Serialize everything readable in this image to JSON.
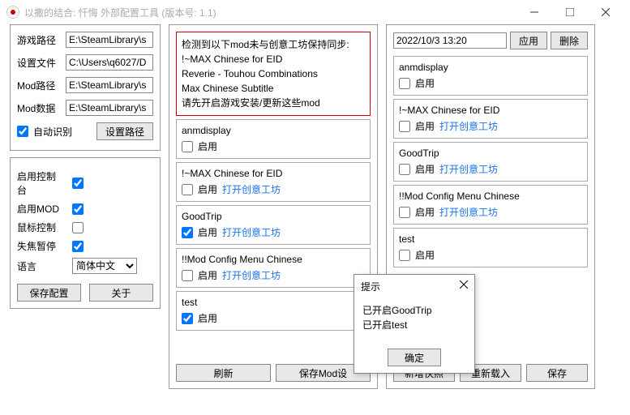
{
  "window": {
    "title": "以撒的结合: 忏悔 外部配置工具   (版本号: 1.1)"
  },
  "paths": {
    "game_label": "游戏路径",
    "game_value": "E:\\SteamLibrary\\s",
    "settings_label": "设置文件",
    "settings_value": "C:\\Users\\q6027/D",
    "mod_label": "Mod路径",
    "mod_value": "E:\\SteamLibrary\\s",
    "moddata_label": "Mod数据",
    "moddata_value": "E:\\SteamLibrary\\s",
    "auto_detect": "自动识别",
    "set_path": "设置路径"
  },
  "options": {
    "enable_console": "启用控制台",
    "enable_mod": "启用MOD",
    "mouse_control": "鼠标控制",
    "pause_on_blur": "失焦暂停",
    "language_label": "语言",
    "language_value": "简体中文",
    "save_config": "保存配置",
    "about": "关于"
  },
  "alert": {
    "l1": "检测到以下mod未与创意工坊保持同步:",
    "l2": "!~MAX Chinese for EID",
    "l3": "Reverie - Touhou Combinations",
    "l4": "Max Chinese Subtitle",
    "l5": "请先开启游戏安装/更新这些mod"
  },
  "common": {
    "enable": "启用",
    "workshop": "打开创意工坊"
  },
  "mods": {
    "m1": "anmdisplay",
    "m2": "!~MAX Chinese for EID",
    "m3": "GoodTrip",
    "m4": "!!Mod Config Menu Chinese",
    "m5": "test"
  },
  "col2_buttons": {
    "refresh": "刷新",
    "save_mod": "保存Mod设"
  },
  "snapshot": {
    "timestamp": "2022/10/3 13:20",
    "apply": "应用",
    "delete": "删除",
    "new_snapshot": "新增快照",
    "reload": "重新载入",
    "save": "保存"
  },
  "dialog": {
    "title": "提示",
    "line1": "已开启GoodTrip",
    "line2": "已开启test",
    "ok": "确定"
  }
}
